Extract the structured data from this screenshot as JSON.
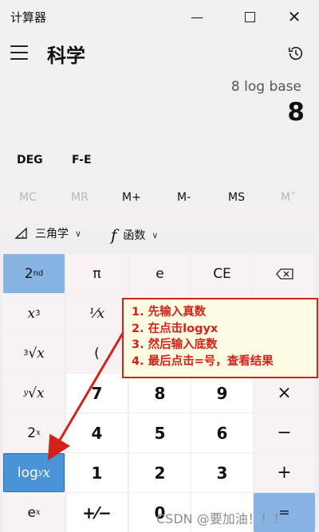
{
  "window": {
    "title": "计算器"
  },
  "header": {
    "mode_title": "科学"
  },
  "display": {
    "expression": "8 log base",
    "value": "8"
  },
  "modes": {
    "angle": "DEG",
    "fe": "F-E"
  },
  "memory": {
    "buttons": [
      {
        "label": "MC",
        "enabled": false
      },
      {
        "label": "MR",
        "enabled": false
      },
      {
        "label": "M+",
        "enabled": true
      },
      {
        "label": "M-",
        "enabled": true
      },
      {
        "label": "MS",
        "enabled": true
      },
      {
        "label": "M˅",
        "enabled": false
      }
    ]
  },
  "functions": {
    "trig_label": "三角学",
    "func_label": "函数",
    "func_symbol": "f"
  },
  "keypad": {
    "second": "2",
    "second_sup": "nd",
    "pi": "π",
    "e": "e",
    "ce": "CE",
    "cube_base": "x",
    "cube_sup": "3",
    "reciprocal": "¹⁄x",
    "cbrt_idx": "3",
    "cbrt_rad": "√x",
    "open_paren": "(",
    "yroot_idx": "y",
    "yroot_rad": "√x",
    "seven": "7",
    "eight": "8",
    "nine": "9",
    "multiply": "×",
    "two_base": "2",
    "two_sup": "x",
    "four": "4",
    "five": "5",
    "six": "6",
    "minus": "−",
    "log_main": "log",
    "log_sub": "y",
    "log_x": "x",
    "one": "1",
    "two": "2",
    "three": "3",
    "plus": "+",
    "ex_base": "e",
    "ex_sup": "x",
    "negate": "+⁄−",
    "zero": "0",
    "equals": "="
  },
  "annotation": {
    "lines": [
      "1. 先输入真数",
      "2. 在点击logyx",
      "3. 然后输入底数",
      "4. 最后点击=号，查看结果"
    ]
  },
  "watermark": "CSDN @要加油！！！",
  "colors": {
    "accent": "#4a93d6",
    "second_active": "#86b3e2",
    "annotation_red": "#d1221b"
  }
}
